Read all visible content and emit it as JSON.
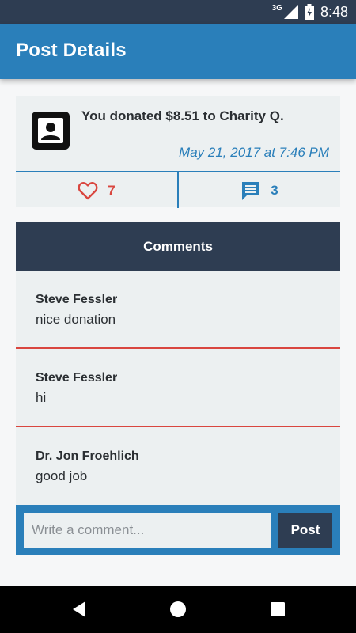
{
  "status_bar": {
    "network": "3G",
    "time": "8:48"
  },
  "app_bar": {
    "title": "Post Details"
  },
  "post": {
    "text": "You donated $8.51 to Charity Q.",
    "timestamp": "May 21, 2017 at 7:46 PM",
    "likes": "7",
    "comments_count": "3",
    "avatar_icon": "person-icon"
  },
  "comments": {
    "header": "Comments",
    "items": [
      {
        "author": "Steve Fessler",
        "text": "nice donation"
      },
      {
        "author": "Steve Fessler",
        "text": "hi"
      },
      {
        "author": "Dr. Jon Froehlich",
        "text": "good job"
      }
    ]
  },
  "composer": {
    "placeholder": "Write a comment...",
    "value": "",
    "button_label": "Post"
  },
  "colors": {
    "primary": "#2a7fba",
    "dark": "#2e3d52",
    "accent": "#d9463f",
    "card": "#ecf0f1"
  }
}
